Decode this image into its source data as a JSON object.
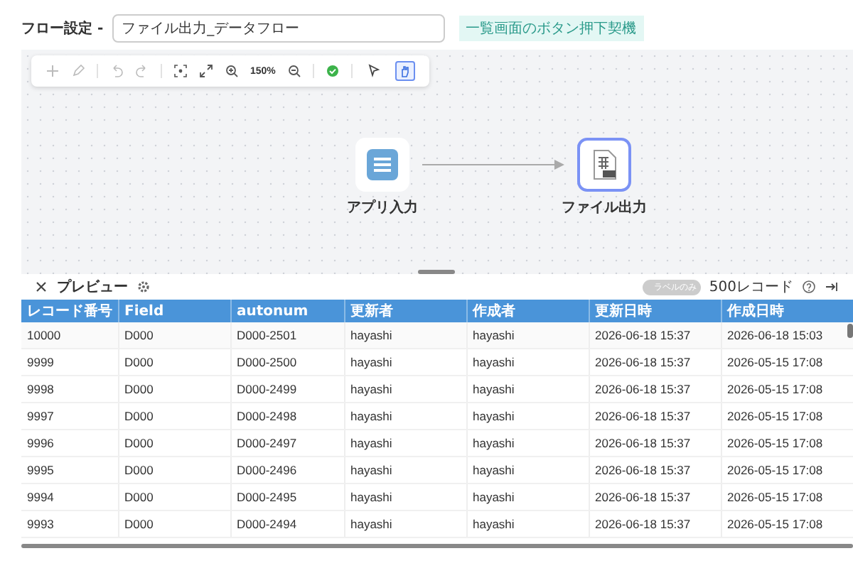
{
  "header": {
    "label": "フロー設定 -",
    "title_value": "ファイル出力_データフロー",
    "trigger_badge": "一覧画面のボタン押下契機"
  },
  "toolbar": {
    "zoom": "150%",
    "modes": [
      {
        "kind": "pointer",
        "selected": false
      },
      {
        "kind": "hand",
        "selected": true
      }
    ]
  },
  "nodes": [
    {
      "label": "アプリ入力",
      "kind": "app",
      "selected": false
    },
    {
      "label": "ファイル出力",
      "kind": "csv",
      "selected": true
    }
  ],
  "preview": {
    "title": "プレビュー",
    "toggle": {
      "label": "ラベルのみ",
      "on": false
    },
    "record_count": "500レコード"
  },
  "table": {
    "columns": [
      "レコード番号",
      "Field",
      "autonum",
      "更新者",
      "作成者",
      "更新日時",
      "作成日時"
    ],
    "rows": [
      [
        "10000",
        "D000",
        "D000-2501",
        "hayashi",
        "hayashi",
        "2026-06-18 15:37",
        "2026-06-18 15:03"
      ],
      [
        "9999",
        "D000",
        "D000-2500",
        "hayashi",
        "hayashi",
        "2026-06-18 15:37",
        "2026-05-15 17:08"
      ],
      [
        "9998",
        "D000",
        "D000-2499",
        "hayashi",
        "hayashi",
        "2026-06-18 15:37",
        "2026-05-15 17:08"
      ],
      [
        "9997",
        "D000",
        "D000-2498",
        "hayashi",
        "hayashi",
        "2026-06-18 15:37",
        "2026-05-15 17:08"
      ],
      [
        "9996",
        "D000",
        "D000-2497",
        "hayashi",
        "hayashi",
        "2026-06-18 15:37",
        "2026-05-15 17:08"
      ],
      [
        "9995",
        "D000",
        "D000-2496",
        "hayashi",
        "hayashi",
        "2026-06-18 15:37",
        "2026-05-15 17:08"
      ],
      [
        "9994",
        "D000",
        "D000-2495",
        "hayashi",
        "hayashi",
        "2026-06-18 15:37",
        "2026-05-15 17:08"
      ],
      [
        "9993",
        "D000",
        "D000-2494",
        "hayashi",
        "hayashi",
        "2026-06-18 15:37",
        "2026-05-15 17:08"
      ]
    ]
  }
}
